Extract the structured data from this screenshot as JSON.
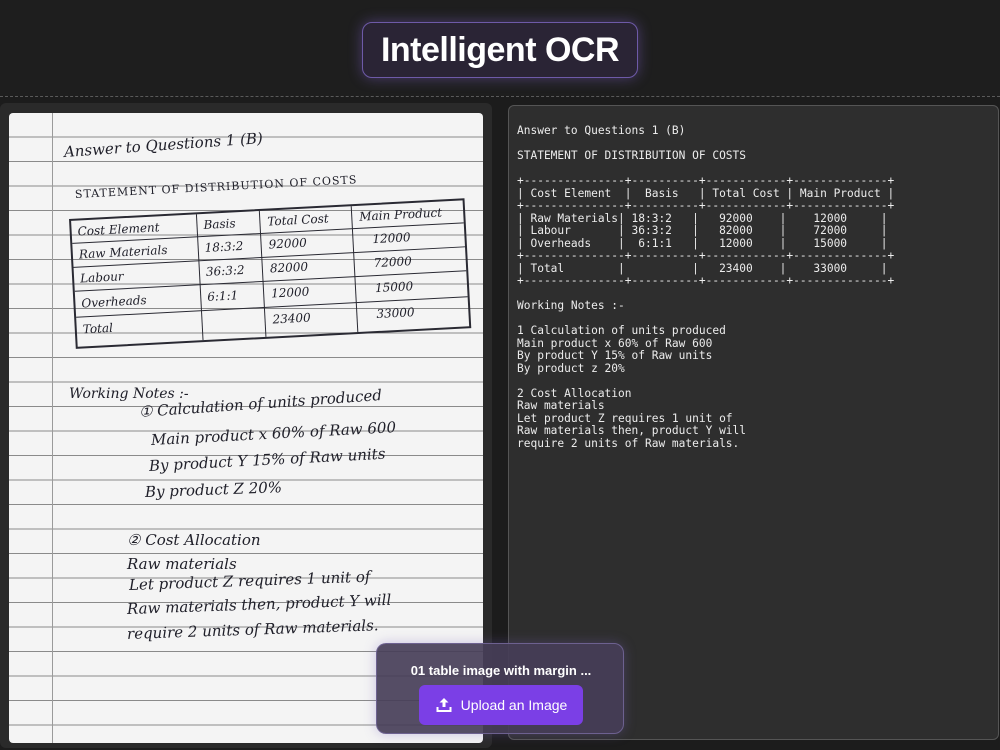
{
  "header": {
    "title": "Intelligent OCR"
  },
  "image_panel": {
    "handwritten": {
      "title": "Answer to Questions 1 (B)",
      "statement": "STATEMENT OF DISTRIBUTION OF COSTS",
      "table": {
        "headers": [
          "Cost Element",
          "Basis",
          "Total Cost",
          "Main Product"
        ],
        "rows": [
          [
            "Raw Materials",
            "18:3:2",
            "92000",
            "12000"
          ],
          [
            "Labour",
            "36:3:2",
            "82000",
            "72000"
          ],
          [
            "Overheads",
            "6:1:1",
            "12000",
            "15000"
          ],
          [
            "Total",
            "",
            "23400",
            "33000"
          ]
        ]
      },
      "notes_title": "Working Notes :-",
      "notes": [
        "① Calculation of units produced",
        "Main product x 60% of Raw 600",
        "By product Y 15% of Raw units",
        "By product Z 20%"
      ],
      "cost_allocation": [
        "② Cost Allocation",
        "Raw materials",
        "Let product Z requires 1 unit of",
        "Raw materials then, product Y will",
        "require 2 units of Raw materials."
      ]
    }
  },
  "result_panel": {
    "text": "Answer to Questions 1 (B)\n\nSTATEMENT OF DISTRIBUTION OF COSTS\n\n+---------------+----------+------------+--------------+\n| Cost Element  |  Basis   | Total Cost | Main Product |\n+---------------+----------+------------+--------------+\n| Raw Materials| 18:3:2   |   92000    |    12000     |\n| Labour       | 36:3:2   |   82000    |    72000     |\n| Overheads    |  6:1:1   |   12000    |    15000     |\n+---------------+----------+------------+--------------+\n| Total        |          |   23400    |    33000     |\n+---------------+----------+------------+--------------+\n\nWorking Notes :-\n\n1 Calculation of units produced\nMain product x 60% of Raw 600\nBy product Y 15% of Raw units\nBy product z 20%\n\n2 Cost Allocation\nRaw materials\nLet product Z requires 1 unit of\nRaw materials then, product Y will\nrequire 2 units of Raw materials."
  },
  "upload": {
    "file_name": "01 table image with margin ...",
    "button_label": "Upload an Image",
    "icon": "upload-icon",
    "accent_color": "#7b3fe6"
  }
}
